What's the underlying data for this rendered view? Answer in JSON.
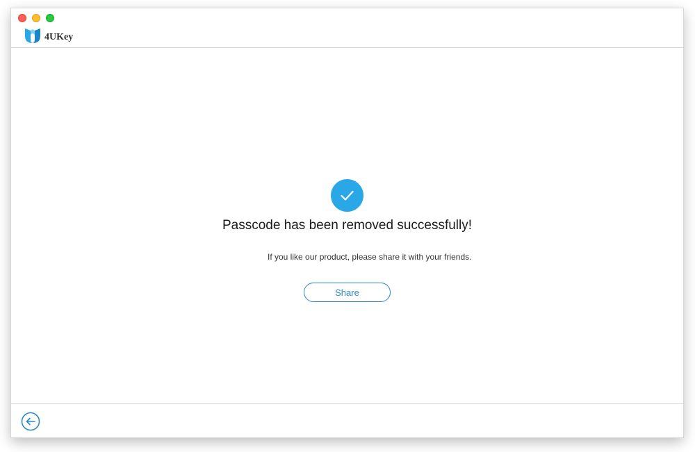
{
  "app": {
    "name": "4UKey",
    "logo_icon": "4ukey-logo-icon",
    "brand_color": "#2aa7e6"
  },
  "window_controls": {
    "close_icon": "close-dot-icon",
    "minimize_icon": "minimize-dot-icon",
    "maximize_icon": "maximize-dot-icon"
  },
  "main": {
    "status_icon": "check-circle-icon",
    "status_color": "#2aa7e6",
    "headline": "Passcode has been removed successfully!",
    "subtext": "If you like our product, please share it with your friends.",
    "share_label": "Share",
    "share_color": "#2c88c4"
  },
  "footer": {
    "back_icon": "arrow-left-circle-icon",
    "back_color": "#2c88c4"
  }
}
